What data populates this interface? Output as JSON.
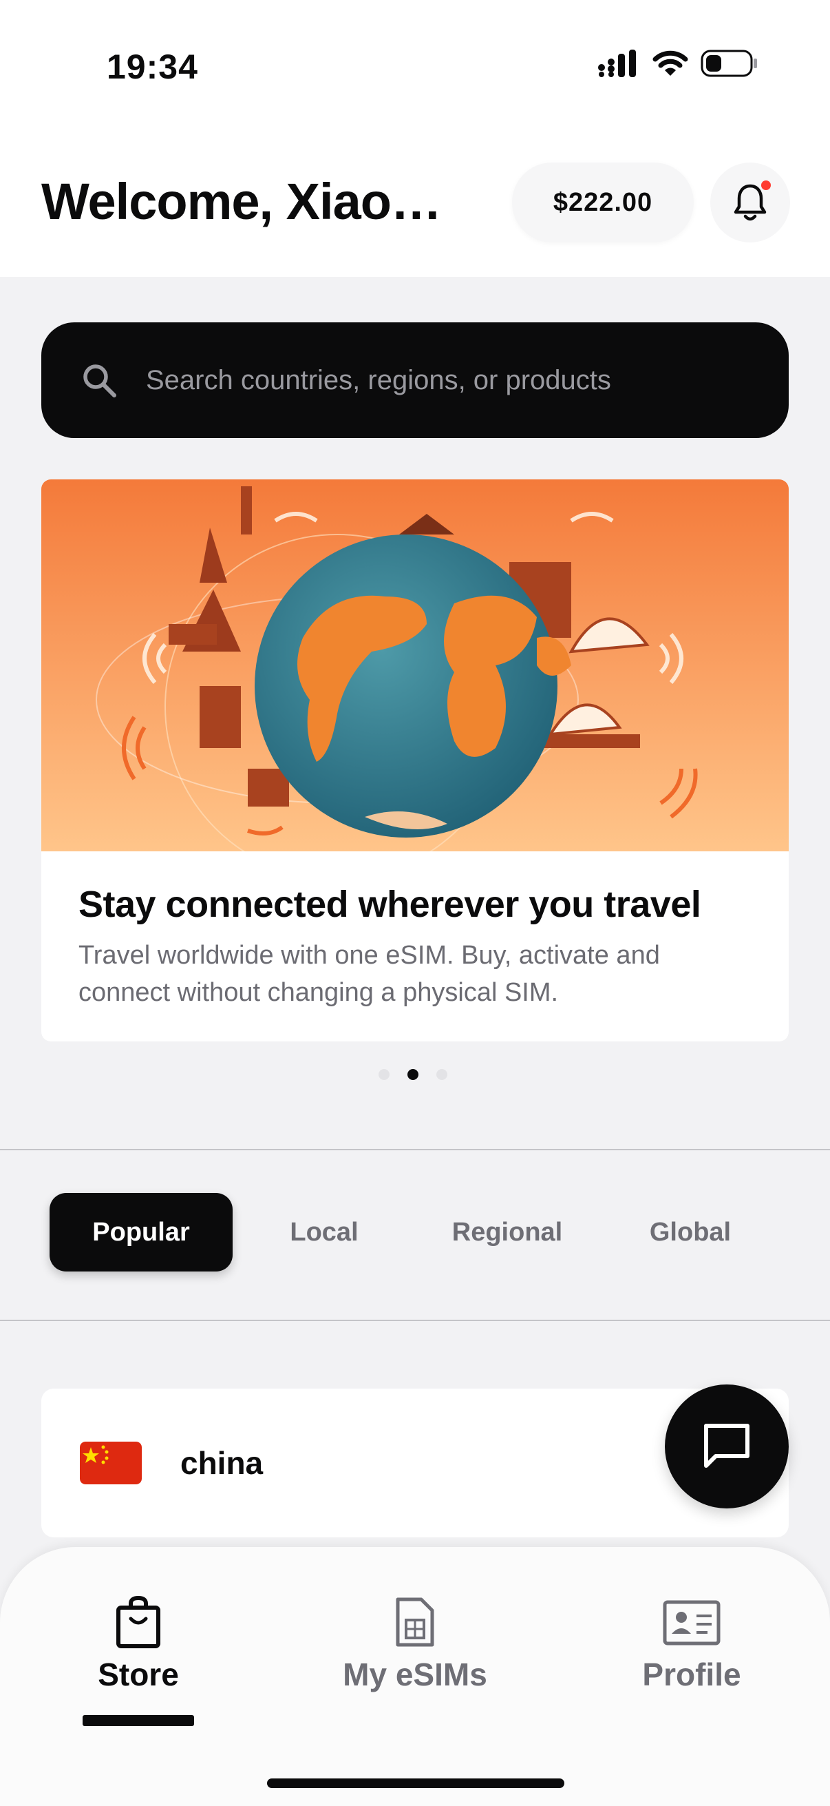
{
  "status_bar": {
    "time": "19:34",
    "icons": [
      "cellular-signal-icon",
      "wifi-icon",
      "battery-icon"
    ]
  },
  "header": {
    "welcome": "Welcome, Xiao…",
    "balance": "$222.00",
    "notification_icon": "bell-icon",
    "has_unread": true
  },
  "search": {
    "placeholder": "Search countries, regions, or products",
    "icon": "search-icon"
  },
  "banner": {
    "image": "globe-travel-landmarks-illustration",
    "title": "Stay connected wherever you travel",
    "subtitle": "Travel worldwide with one eSIM. Buy, activate and connect without changing a physical SIM.",
    "dot_count": 3,
    "active_dot": 1
  },
  "tabs": [
    {
      "label": "Popular",
      "active": true
    },
    {
      "label": "Local",
      "active": false
    },
    {
      "label": "Regional",
      "active": false
    },
    {
      "label": "Global",
      "active": false
    }
  ],
  "countries": [
    {
      "name": "china",
      "flag": "china-flag-icon"
    }
  ],
  "chat_button": {
    "icon": "chat-bubble-icon"
  },
  "bottom_nav": [
    {
      "label": "Store",
      "icon": "shopping-bag-icon",
      "active": true
    },
    {
      "label": "My eSIMs",
      "icon": "sim-card-icon",
      "active": false
    },
    {
      "label": "Profile",
      "icon": "id-card-icon",
      "active": false
    }
  ],
  "colors": {
    "accent": "#0b0b0c",
    "notification_dot": "#ff3b30",
    "banner_orange": "#f47a3a"
  }
}
